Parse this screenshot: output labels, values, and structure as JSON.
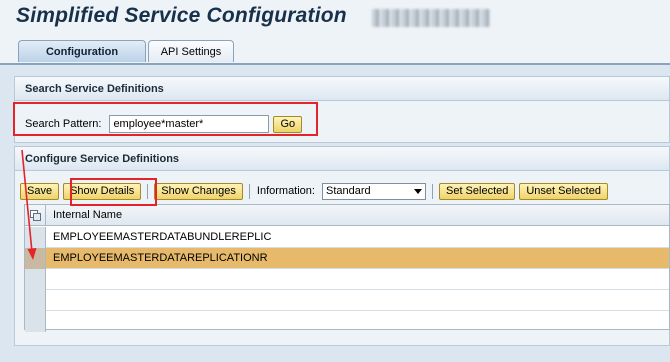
{
  "app": {
    "title": "Simplified Service Configuration"
  },
  "tabs": [
    {
      "label": "Configuration",
      "active": true
    },
    {
      "label": "API Settings",
      "active": false
    }
  ],
  "search": {
    "header": "Search Service Definitions",
    "pattern_label": "Search Pattern:",
    "pattern_value": "employee*master*",
    "go_label": "Go"
  },
  "config": {
    "header": "Configure Service Definitions",
    "toolbar": {
      "save_label": "Save",
      "show_details_label": "Show Details",
      "show_changes_label": "Show Changes",
      "information_label": "Information:",
      "information_value": "Standard",
      "set_selected_label": "Set Selected",
      "unset_selected_label": "Unset Selected"
    },
    "table": {
      "columns": [
        "Internal Name"
      ],
      "rows": [
        {
          "internal_name": "EMPLOYEEMASTERDATABUNDLEREPLIC",
          "selected": false
        },
        {
          "internal_name": "EMPLOYEEMASTERDATAREPLICATIONR",
          "selected": true
        },
        {
          "internal_name": "",
          "selected": false
        },
        {
          "internal_name": "",
          "selected": false
        },
        {
          "internal_name": "",
          "selected": false
        }
      ]
    }
  },
  "colors": {
    "selected_row": "#e7b96b",
    "annotation": "#e5232b",
    "button_fill": "#efd36a"
  }
}
